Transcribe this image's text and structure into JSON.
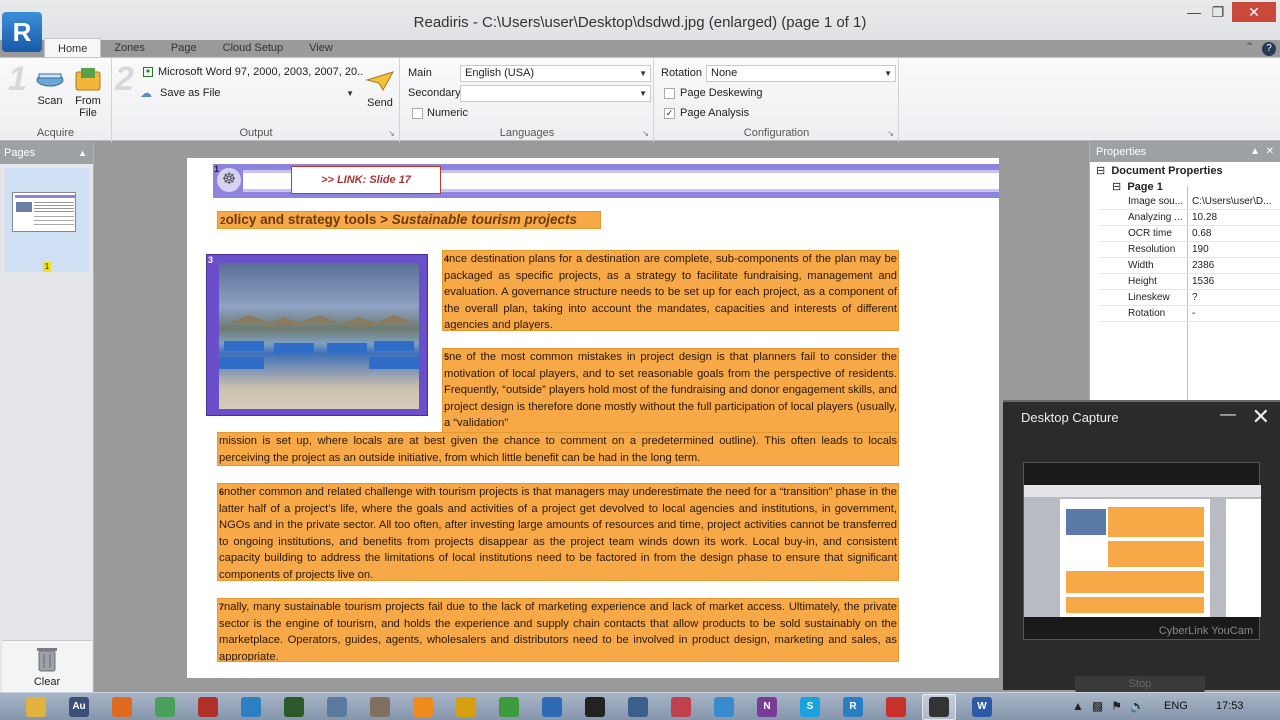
{
  "window": {
    "title": "Readiris - C:\\Users\\user\\Desktop\\dsdwd.jpg (enlarged) (page 1 of 1)",
    "logo_letter": "R",
    "minimize": "—",
    "maximize": "❐",
    "close": "✕"
  },
  "tabs": [
    "Home",
    "Zones",
    "Page",
    "Cloud Setup",
    "View"
  ],
  "ribbon": {
    "acquire": {
      "label": "Acquire",
      "step": "1",
      "scan": "Scan",
      "from_file_line1": "From",
      "from_file_line2": "File"
    },
    "output": {
      "label": "Output",
      "step": "2",
      "format": "Microsoft Word 97, 2000, 2003, 2007, 20...",
      "destination": "Save as File",
      "send": "Send"
    },
    "languages": {
      "label": "Languages",
      "main_label": "Main",
      "main_value": "English (USA)",
      "secondary_label": "Secondary",
      "secondary_value": "",
      "numeric_label": "Numeric",
      "numeric_checked": false
    },
    "configuration": {
      "label": "Configuration",
      "rotation_label": "Rotation",
      "rotation_value": "None",
      "page_deskewing": "Page Deskewing",
      "page_deskewing_checked": false,
      "page_analysis": "Page Analysis",
      "page_analysis_checked": true
    }
  },
  "pages_pane": {
    "title": "Pages",
    "page_number": "1",
    "clear": "Clear"
  },
  "document": {
    "zone_numbers": [
      "1",
      "2",
      "3",
      "4",
      "5",
      "6",
      "7"
    ],
    "link_text": ">> LINK: Slide 17",
    "heading_plain": "olicy and strategy tools  > ",
    "heading_italic": "Sustainable tourism projects",
    "para1": "nce destination plans for a destination are complete, sub-components of the plan may be packaged as specific projects, as a strategy to facilitate fundraising, management and evaluation. A governance structure needs to be set up for each project, as a component of the overall plan, taking into account the mandates, capacities and interests of different agencies and players.",
    "para2a": "ne of the most common mistakes in project design is that planners fail to consider the motivation of local players, and to set reasonable goals from the perspective of residents. Frequently, “outside” players hold most of the fundraising and donor engagement skills, and project design is therefore done mostly without the full participation of local players (usually, a “validation”",
    "para2b": "mission is set up, where locals are at best given the chance to comment on a predetermined outline). This often leads to locals perceiving the project as an outside initiative, from which little benefit can be had in the long term.",
    "para3": "nother common and related challenge with tourism projects is that managers may underestimate the need for a “transition” phase in the latter half of a project’s life, where the goals and activities of a project get devolved to local agencies and institutions, in government, NGOs and in the private sector. All too often, after investing large amounts of resources and time, project activities cannot be transferred to ongoing institutions, and benefits from projects disappear as the project team winds down its work. Local buy-in, and consistent capacity building to address the limitations of local institutions need to be factored in from the design phase to ensure that significant components of projects live on.",
    "para4": "nally, many sustainable tourism projects fail due to the lack of marketing experience and lack of market access. Ultimately, the private sector is the engine of tourism, and holds the experience and supply chain contacts that allow products to be sold sustainably on the marketplace. Operators, guides, agents, wholesalers and distributors need to be involved in product design, marketing and sales, as appropriate."
  },
  "properties": {
    "title": "Properties",
    "section": "Document Properties",
    "subsection": "Page 1",
    "rows": [
      {
        "key": "Image sou...",
        "value": "C:\\Users\\user\\D..."
      },
      {
        "key": "Analyzing ...",
        "value": "10.28"
      },
      {
        "key": "OCR time",
        "value": "0.68"
      },
      {
        "key": "Resolution",
        "value": "190"
      },
      {
        "key": "Width",
        "value": "2386"
      },
      {
        "key": "Height",
        "value": "1536"
      },
      {
        "key": "Lineskew",
        "value": "?"
      },
      {
        "key": "Rotation",
        "value": "-"
      }
    ]
  },
  "capture": {
    "title": "Desktop Capture",
    "watermark": "CyberLink YouCam",
    "stop": "Stop"
  },
  "taskbar": {
    "lang": "ENG",
    "time": "17:53",
    "apps": [
      {
        "name": "explorer-icon",
        "label": "",
        "color": "#e3b341"
      },
      {
        "name": "audition-icon",
        "label": "Au",
        "color": "#3b4f7a"
      },
      {
        "name": "firefox-icon",
        "label": "",
        "color": "#e06a1f"
      },
      {
        "name": "people-icon",
        "label": "",
        "color": "#4aa05a"
      },
      {
        "name": "tool-icon",
        "label": "",
        "color": "#b0302a"
      },
      {
        "name": "chart-icon",
        "label": "",
        "color": "#2c7fc1"
      },
      {
        "name": "flag-icon",
        "label": "",
        "color": "#2a5a2a"
      },
      {
        "name": "keyboard-icon",
        "label": "",
        "color": "#5a7aa0"
      },
      {
        "name": "wrench-icon",
        "label": "",
        "color": "#807060"
      },
      {
        "name": "vlc-icon",
        "label": "",
        "color": "#f08a1c"
      },
      {
        "name": "chrome-icon",
        "label": "",
        "color": "#d4a010"
      },
      {
        "name": "leaf-icon",
        "label": "",
        "color": "#3d9a3d"
      },
      {
        "name": "globe-icon",
        "label": "",
        "color": "#2f6bb5"
      },
      {
        "name": "ball-icon",
        "label": "",
        "color": "#222222"
      },
      {
        "name": "pen-icon",
        "label": "",
        "color": "#3b5f8a"
      },
      {
        "name": "shape-icon",
        "label": "",
        "color": "#c04050"
      },
      {
        "name": "refresh-icon",
        "label": "",
        "color": "#3a8ad0"
      },
      {
        "name": "onenote-icon",
        "label": "N",
        "color": "#7a3a9a"
      },
      {
        "name": "skype-icon",
        "label": "S",
        "color": "#1aa2e0"
      },
      {
        "name": "readiris-icon",
        "label": "R",
        "color": "#2a7fc4"
      },
      {
        "name": "pdf-icon",
        "label": "",
        "color": "#c8302a"
      },
      {
        "name": "camera-icon",
        "label": "",
        "color": "#333333"
      },
      {
        "name": "word-icon",
        "label": "W",
        "color": "#2b5aa8"
      }
    ]
  },
  "colors": {
    "zone_text": "#f7a847",
    "zone_image": "#6b4ec9",
    "zone_link": "#8d84dd",
    "accent": "#2a7fc4"
  }
}
